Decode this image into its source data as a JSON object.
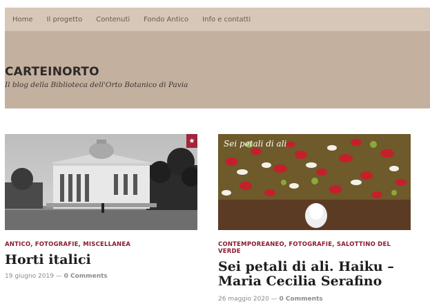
{
  "nav": {
    "items": [
      "Home",
      "Il progetto",
      "Contenuti",
      "Fondo Antico",
      "Info e contatti"
    ]
  },
  "site": {
    "title": "CARTEINORTO",
    "tagline": "Il blog della Biblioteca dell'Orto Botanico di Pavia"
  },
  "posts": [
    {
      "categories": "ANTICO, FOTOGRAFIE, MISCELLANEA",
      "title": "Horti italici",
      "date": "19 giugno 2019",
      "sep": " — ",
      "comments": "0 Comments",
      "image_alt": "Archival photo of a neoclassical building with a dome"
    },
    {
      "categories": "CONTEMPOREANEO, FOTOGRAFIE, SALOTTINO DEL VERDE",
      "title": "Sei petali di ali. Haiku – Maria Cecilia Serafino",
      "date": "26 maggio 2020",
      "sep": " — ",
      "comments": "0 Comments",
      "image_caption": "Sei petali di ali",
      "image_alt": "Petals and a white feather"
    }
  ],
  "colors": {
    "nav_bg": "#d6c7b8",
    "hero_bg": "#c3b09e",
    "category": "#8a1a2d",
    "badge": "#a2243c"
  }
}
